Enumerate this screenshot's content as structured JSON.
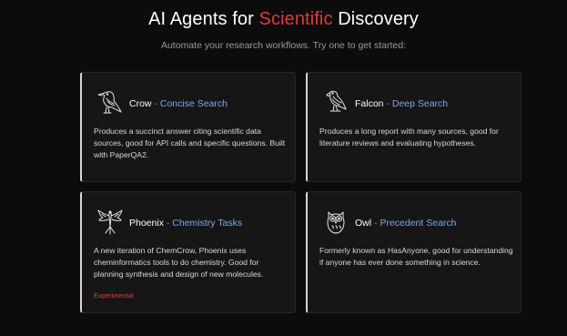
{
  "header": {
    "title_prefix": "AI Agents for ",
    "title_accent": "Scientific",
    "title_suffix": " Discovery",
    "subtitle": "Automate your research workflows. Try one to get started:"
  },
  "colors": {
    "accent": "#e03a3a",
    "mode_blue": "#7fa6e8",
    "background": "#0c0c0c",
    "card": "#161617"
  },
  "agents": [
    {
      "name": "Crow",
      "separator": " - ",
      "mode": "Concise Search",
      "icon": "crow-icon",
      "description": "Produces a succinct answer citing scientific data sources, good for API calls and specific questions. Built with PaperQA2."
    },
    {
      "name": "Falcon",
      "separator": " - ",
      "mode": "Deep Search",
      "icon": "falcon-icon",
      "description": "Produces a long report with many sources, good for literature reviews and evaluating hypotheses."
    },
    {
      "name": "Phoenix",
      "separator": " - ",
      "mode": "Chemistry Tasks",
      "icon": "phoenix-icon",
      "description": "A new iteration of ChemCrow, Phoenix uses cheminformatics tools to do chemistry. Good for planning synthesis and design of new molecules.",
      "badge": "Experimental"
    },
    {
      "name": "Owl",
      "separator": " - ",
      "mode": "Precedent Search",
      "icon": "owl-icon",
      "description": "Formerly known as HasAnyone, good for understanding if anyone has ever done something in science."
    }
  ]
}
